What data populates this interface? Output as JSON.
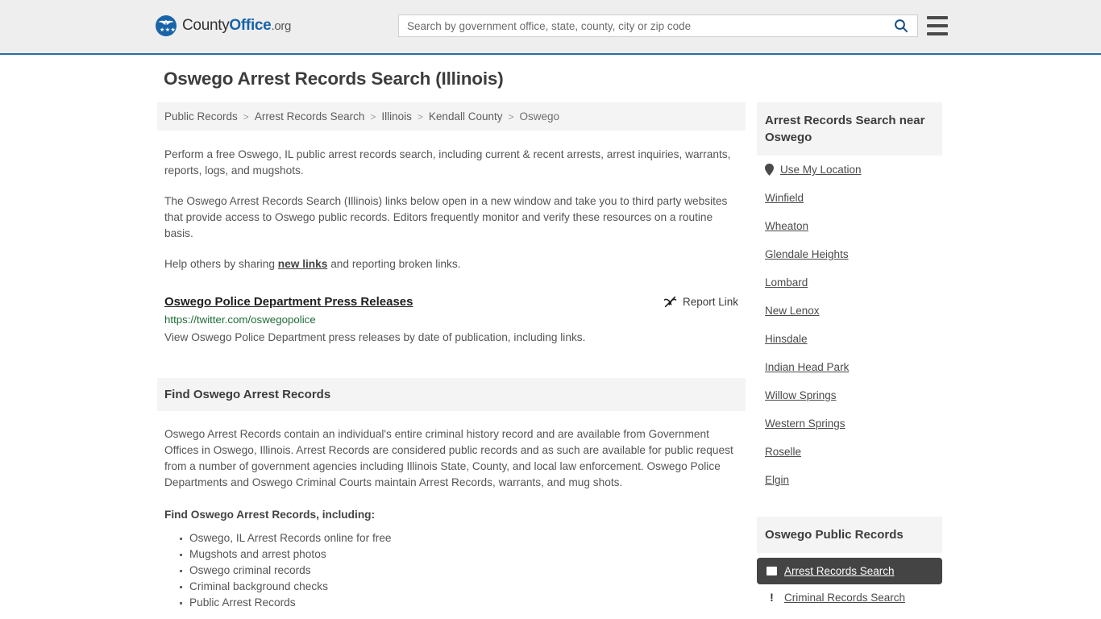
{
  "header": {
    "brand": {
      "part1": "County",
      "part2": "Office",
      "part3": ".org",
      "icon": "eagle-seal-icon"
    },
    "search": {
      "placeholder": "Search by government office, state, county, city or zip code",
      "value": "",
      "search_icon": "search-icon"
    },
    "menu_icon": "hamburger-menu-icon"
  },
  "page": {
    "title": "Oswego Arrest Records Search (Illinois)"
  },
  "breadcrumb": {
    "items": [
      "Public Records",
      "Arrest Records Search",
      "Illinois",
      "Kendall County",
      "Oswego"
    ],
    "separator": ">"
  },
  "intro": {
    "p1": "Perform a free Oswego, IL public arrest records search, including current & recent arrests, arrest inquiries, warrants, reports, logs, and mugshots.",
    "p2": "The Oswego Arrest Records Search (Illinois) links below open in a new window and take you to third party websites that provide access to Oswego public records. Editors frequently monitor and verify these resources on a routine basis.",
    "p3_before": "Help others by sharing ",
    "p3_link": "new links",
    "p3_after": " and reporting broken links."
  },
  "result": {
    "title": "Oswego Police Department Press Releases",
    "url": "https://twitter.com/oswegopolice",
    "description": "View Oswego Police Department press releases by date of publication, including links.",
    "report_label": "Report Link",
    "report_icon": "broken-link-icon"
  },
  "find_panel": {
    "heading": "Find Oswego Arrest Records",
    "body": "Oswego Arrest Records contain an individual's entire criminal history record and are available from Government Offices in Oswego, Illinois. Arrest Records are considered public records and as such are available for public request from a number of government agencies including Illinois State, County, and local law enforcement. Oswego Police Departments and Oswego Criminal Courts maintain Arrest Records, warrants, and mug shots.",
    "list_lead": "Find Oswego Arrest Records, including:",
    "items": [
      "Oswego, IL Arrest Records online for free",
      "Mugshots and arrest photos",
      "Oswego criminal records",
      "Criminal background checks",
      "Public Arrest Records"
    ]
  },
  "sidebar": {
    "nearby": {
      "heading": "Arrest Records Search near Oswego",
      "use_my_location": "Use My Location",
      "location_icon": "map-pin-icon",
      "cities": [
        "Winfield",
        "Wheaton",
        "Glendale Heights",
        "Lombard",
        "New Lenox",
        "Hinsdale",
        "Indian Head Park",
        "Willow Springs",
        "Western Springs",
        "Roselle",
        "Elgin"
      ]
    },
    "public_records": {
      "heading": "Oswego Public Records",
      "items": [
        {
          "label": "Arrest Records Search",
          "icon": "id-card-icon",
          "active": true
        },
        {
          "label": "Criminal Records Search",
          "icon": "exclamation-icon",
          "active": false
        }
      ]
    }
  },
  "colors": {
    "brand_blue": "#1964a8",
    "header_bg": "#eeeeee",
    "header_border": "#2b6ca3",
    "panel_bg": "#f4f4f4",
    "url_green": "#1d6b36",
    "active_bg": "#444444"
  }
}
